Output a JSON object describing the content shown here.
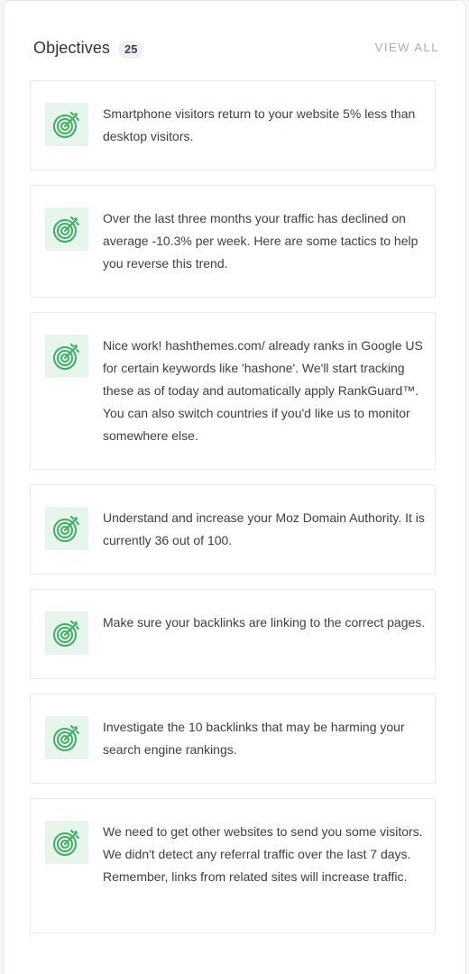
{
  "header": {
    "title": "Objectives",
    "count": "25",
    "view_all": "VIEW ALL"
  },
  "colors": {
    "accent": "#3fae67",
    "icon_bg": "#e7f5ec"
  },
  "items": [
    {
      "icon": "target-icon",
      "text": "Smartphone visitors return to your website 5% less than desktop visitors."
    },
    {
      "icon": "target-icon",
      "text": "Over the last three months your traffic has declined on average -10.3% per week. Here are some tactics to help you reverse this trend."
    },
    {
      "icon": "target-icon",
      "text": "Nice work! hashthemes.com/ already ranks in Google US for certain keywords like 'hashone'. We'll start tracking these as of today and automatically apply RankGuard™. You can also switch countries if you'd like us to monitor somewhere else."
    },
    {
      "icon": "target-icon",
      "text": "Understand and increase your Moz Domain Authority. It is currently 36 out of 100."
    },
    {
      "icon": "target-icon",
      "text": "Make sure your backlinks are linking to the correct pages."
    },
    {
      "icon": "target-icon",
      "text": "Investigate the 10 backlinks that may be harming your search engine rankings."
    },
    {
      "icon": "target-icon",
      "text": "We need to get other websites to send you some visitors. We didn't detect any referral traffic over the last 7 days. Remember, links from related sites will increase traffic."
    }
  ]
}
